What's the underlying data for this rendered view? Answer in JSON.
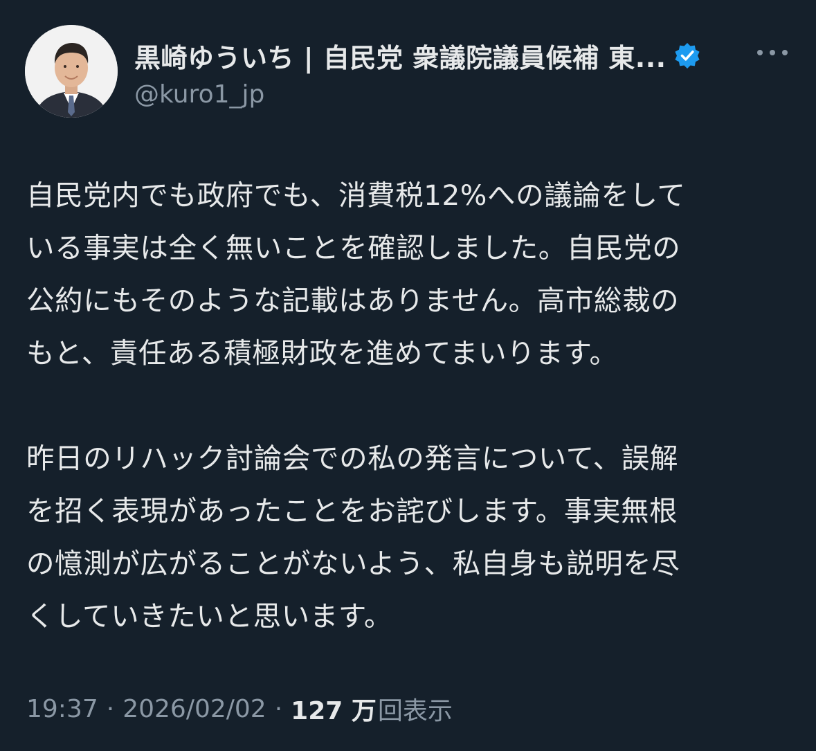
{
  "author": {
    "display_name": "黒崎ゆういち | 自民党 衆議院議員候補 東...",
    "handle": "@kuro1_jp",
    "verified": true,
    "avatar_icon": "profile-photo",
    "verified_icon": "verified-badge-icon",
    "more_icon": "more-options-icon"
  },
  "tweet": {
    "paragraph_1_lines": [
      "自民党内でも政府でも、消費税12%への議論をして",
      "いる事実は全く無いことを確認しました。自民党の",
      "公約にもそのような記載はありません。高市総裁の",
      "もと、責任ある積極財政を進めてまいります。"
    ],
    "paragraph_2_lines": [
      "昨日のリハック討論会での私の発言について、誤解",
      "を招く表現があったことをお詫びします。事実無根",
      "の憶測が広がることがないよう、私自身も説明を尽",
      "くしていきたいと思います。"
    ]
  },
  "meta": {
    "time": "19:37",
    "separator": "·",
    "date": "2026/02/02",
    "views_count": "127 万",
    "views_label": "回表示"
  },
  "colors": {
    "background": "#15202b",
    "text_primary": "#e7e9ea",
    "text_secondary": "#8b98a5",
    "verified_blue": "#1d9bf0"
  }
}
